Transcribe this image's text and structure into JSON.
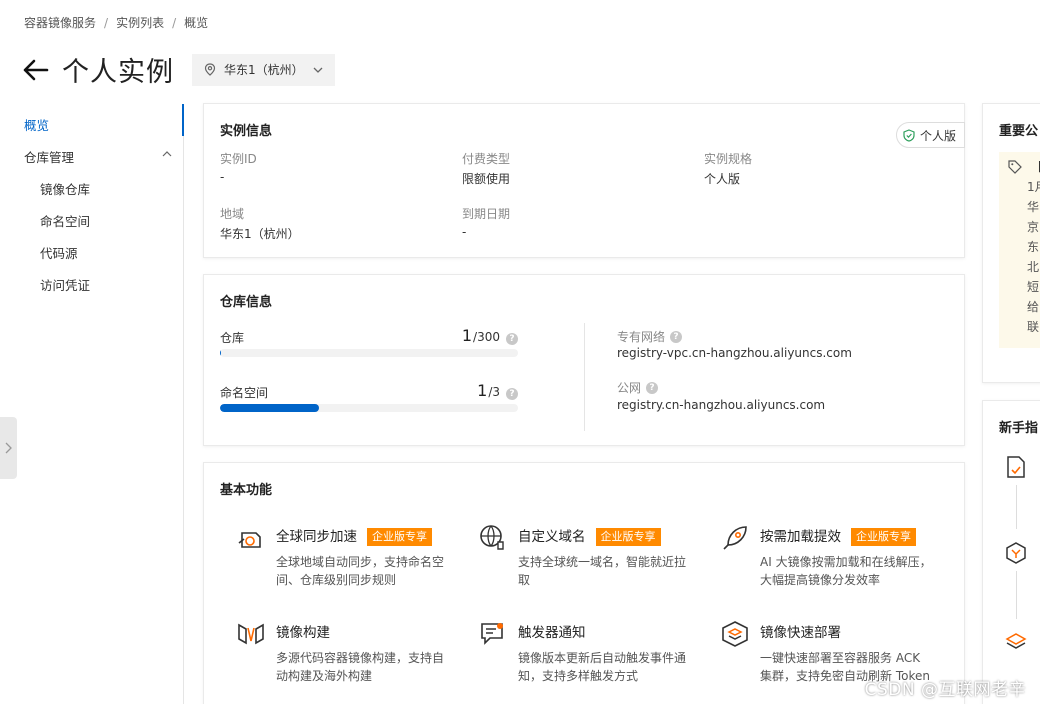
{
  "breadcrumb": [
    "容器镜像服务",
    "实例列表",
    "概览"
  ],
  "header": {
    "title": "个人实例",
    "region": "华东1（杭州）"
  },
  "sidebar": {
    "items": [
      {
        "label": "概览",
        "active": true
      },
      {
        "label": "仓库管理"
      },
      {
        "label": "镜像仓库"
      },
      {
        "label": "命名空间"
      },
      {
        "label": "代码源"
      },
      {
        "label": "访问凭证"
      }
    ]
  },
  "instance_info": {
    "title": "实例信息",
    "edition_tag": "个人版",
    "fields": [
      {
        "label": "实例ID",
        "value": "-"
      },
      {
        "label": "付费类型",
        "value": "限额使用"
      },
      {
        "label": "实例规格",
        "value": "个人版"
      },
      {
        "label": "地域",
        "value": "华东1（杭州）"
      },
      {
        "label": "到期日期",
        "value": "-"
      }
    ]
  },
  "repo_info": {
    "title": "仓库信息",
    "quotas": [
      {
        "label": "仓库",
        "current": "1",
        "total": "/300",
        "fill": 0.0033
      },
      {
        "label": "命名空间",
        "current": "1",
        "total": "/3",
        "fill": 0.3333
      }
    ],
    "network": [
      {
        "label": "专有网络",
        "value": "registry-vpc.cn-hangzhou.aliyuncs.com"
      },
      {
        "label": "公网",
        "value": "registry.cn-hangzhou.aliyuncs.com"
      }
    ]
  },
  "features": {
    "title": "基本功能",
    "badge": "企业版专享",
    "items": [
      {
        "name": "全球同步加速",
        "badge": true,
        "desc": "全球地域自动同步，支持命名空间、仓库级别同步规则",
        "icon": "global-sync-icon"
      },
      {
        "name": "自定义域名",
        "badge": true,
        "desc": "支持全球统一域名，智能就近拉取",
        "icon": "custom-domain-icon"
      },
      {
        "name": "按需加载提效",
        "badge": true,
        "desc": "AI 大镜像按需加载和在线解压，大幅提高镜像分发效率",
        "icon": "rocket-icon"
      },
      {
        "name": "镜像构建",
        "badge": false,
        "desc": "多源代码容器镜像构建，支持自动构建及海外构建",
        "icon": "image-build-icon"
      },
      {
        "name": "触发器通知",
        "badge": false,
        "desc": "镜像版本更新后自动触发事件通知，支持多样触发方式",
        "icon": "trigger-notify-icon"
      },
      {
        "name": "镜像快速部署",
        "badge": false,
        "desc": "一键快速部署至容器服务 ACK 集群，支持免密自动刷新 Token",
        "icon": "quick-deploy-icon"
      }
    ]
  },
  "right_panel": {
    "notice_title": "重要公",
    "notice_lines": [
      "【",
      "1月",
      "华",
      "京",
      "东",
      "北",
      "短",
      "给",
      "联"
    ],
    "guide_title": "新手指"
  },
  "watermark": "CSDN @互联网老辛",
  "colors": {
    "primary": "#0064c8",
    "badge": "#ff8a00",
    "notice_bg": "#fdf9ea"
  }
}
